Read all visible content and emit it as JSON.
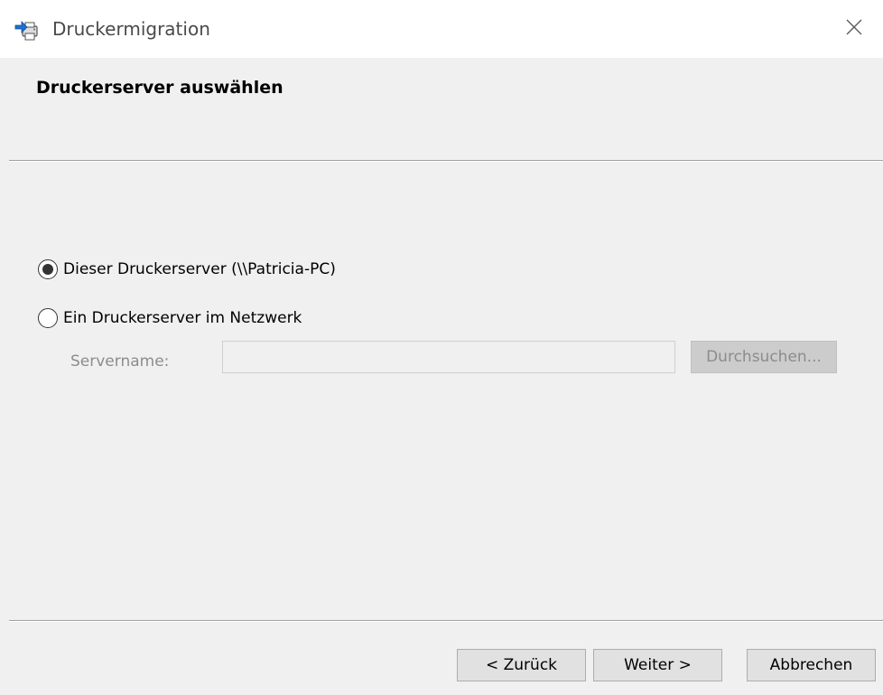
{
  "window": {
    "title": "Druckermigration"
  },
  "header": {
    "page_title": "Druckerserver auswählen"
  },
  "options": {
    "local_server": {
      "label": "Dieser Druckerserver (\\\\Patricia-PC)",
      "selected": true
    },
    "network_server": {
      "label": "Ein Druckerserver im Netzwerk",
      "selected": false
    },
    "server_name": {
      "label": "Servername:",
      "value": "",
      "enabled": false
    },
    "browse_label": "Durchsuchen..."
  },
  "footer": {
    "back_label": "< Zurück",
    "next_label": "Weiter >",
    "cancel_label": "Abbrechen"
  },
  "icons": {
    "app": "printer-migration-icon",
    "close": "close-icon"
  },
  "colors": {
    "window_bg": "#f0f0f0",
    "titlebar_bg": "#ffffff",
    "disabled_text": "#8c8c8c",
    "button_bg": "#e1e1e1"
  }
}
